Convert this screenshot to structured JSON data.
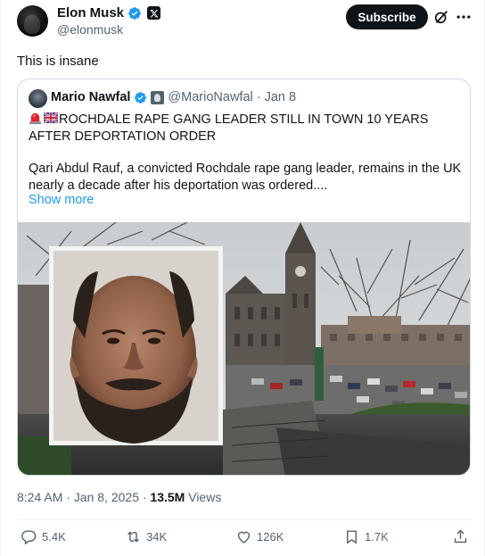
{
  "author": {
    "display_name": "Elon Musk",
    "handle": "@elonmusk",
    "avatar_icon": "avatar-photo"
  },
  "header": {
    "subscribe_label": "Subscribe",
    "grok_icon": "grok-icon",
    "more_icon": "more-icon"
  },
  "tweet": {
    "text": "This is insane",
    "timestamp": "8:24 AM · Jan 8, 2025 · ",
    "views_count": "13.5M",
    "views_label": " Views"
  },
  "quote": {
    "display_name": "Mario Nawfal",
    "handle_date": "@MarioNawfal · Jan 8",
    "headline": "ROCHDALE RAPE GANG LEADER STILL IN TOWN 10 YEARS AFTER DEPORTATION ORDER",
    "body": "Qari Abdul Rauf, a convicted Rochdale rape gang leader, remains in the UK nearly a decade after his deportation was ordered....",
    "show_more": "Show more"
  },
  "actions": {
    "replies": "5.4K",
    "reposts": "34K",
    "likes": "126K",
    "bookmarks": "1.7K"
  },
  "colors": {
    "verified": "#1d9bf0",
    "link": "#1d9bf0",
    "text": "#0f1419",
    "muted": "#536471"
  }
}
